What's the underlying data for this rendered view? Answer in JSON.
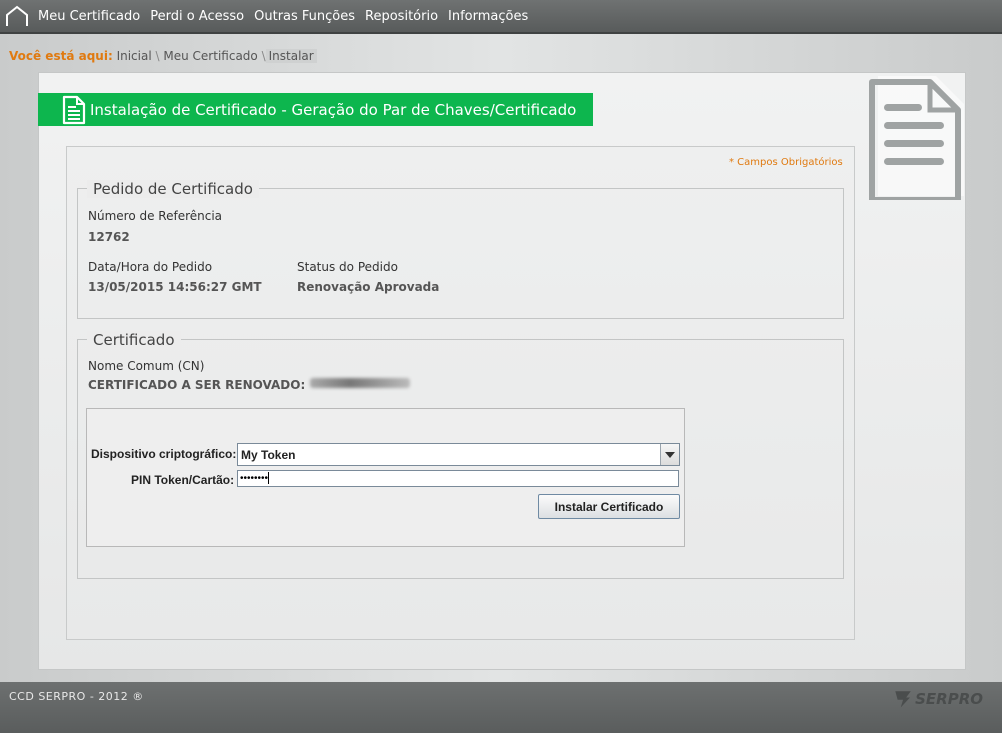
{
  "nav": {
    "items": [
      {
        "label": "Meu Certificado"
      },
      {
        "label": "Perdi o Acesso"
      },
      {
        "label": "Outras Funções"
      },
      {
        "label": "Repositório"
      },
      {
        "label": "Informações"
      }
    ]
  },
  "breadcrumb": {
    "prefix": "Você está aqui:",
    "items": [
      "Inicial",
      "Meu Certificado",
      "Instalar"
    ],
    "separator": "\\"
  },
  "page": {
    "title": "Instalação de Certificado - Geração do Par de Chaves/Certificado",
    "required_note": "* Campos Obrigatórios"
  },
  "pedido": {
    "legend": "Pedido de Certificado",
    "ref_label": "Número de Referência",
    "ref_value": "12762",
    "datetime_label": "Data/Hora do Pedido",
    "datetime_value": "13/05/2015 14:56:27 GMT",
    "status_label": "Status do Pedido",
    "status_value": "Renovação Aprovada"
  },
  "certificado": {
    "legend": "Certificado",
    "cn_label": "Nome Comum (CN)",
    "cn_value": "CERTIFICADO A SER RENOVADO:"
  },
  "applet": {
    "device_label": "Dispositivo criptográfico:",
    "device_value": "My Token",
    "pin_label": "PIN Token/Cartão:",
    "pin_value": "••••••••",
    "install_label": "Instalar Certificado"
  },
  "footer": {
    "copyright": "CCD SERPRO - 2012 ®",
    "logo_text": "SERPRO"
  },
  "colors": {
    "accent_green": "#0db64e",
    "accent_orange": "#e07a10",
    "nav_bg": "#5f6262"
  }
}
